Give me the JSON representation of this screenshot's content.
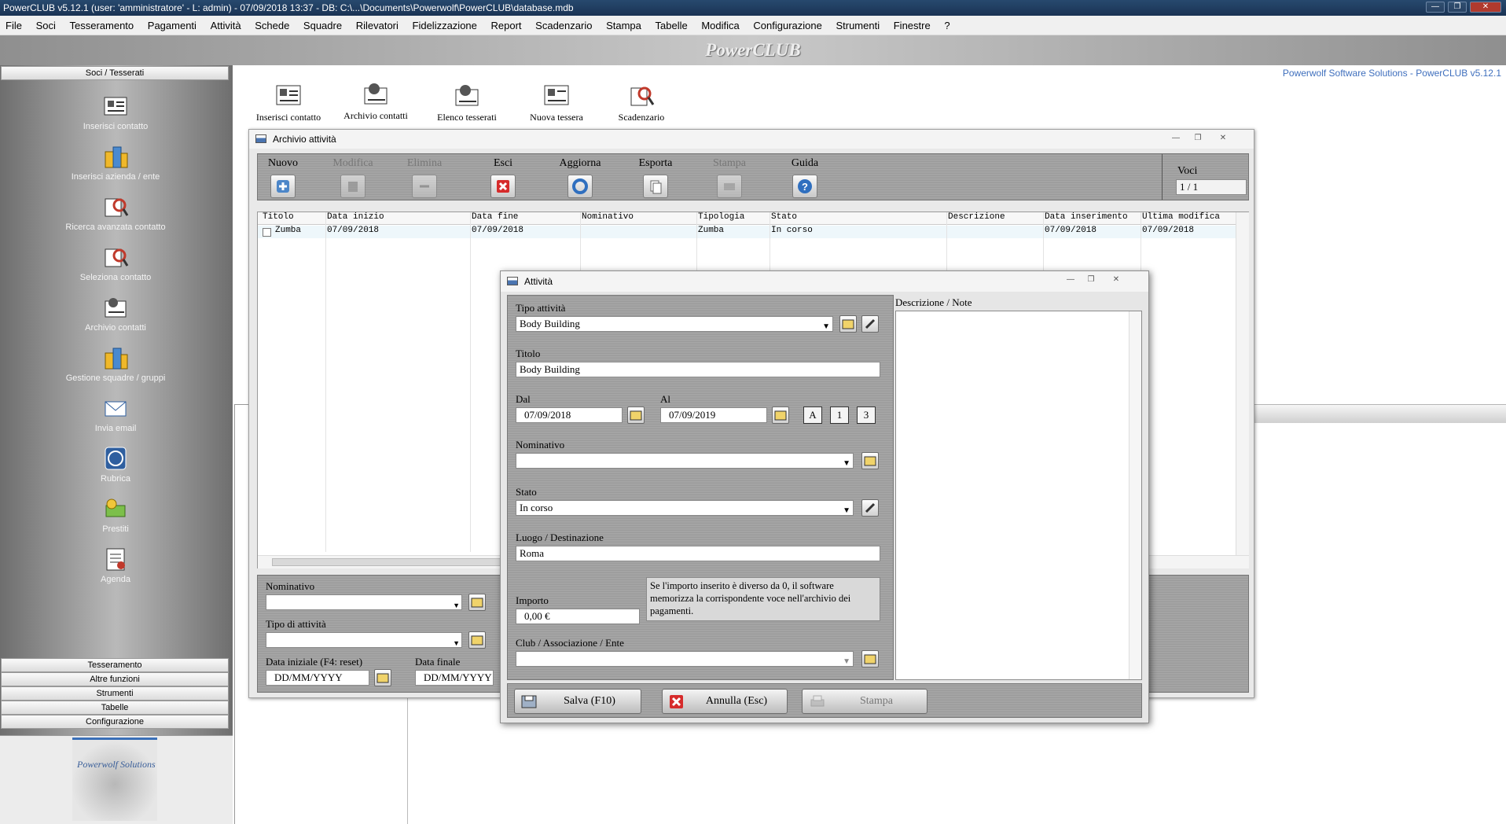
{
  "window": {
    "title": "PowerCLUB v5.12.1  (user: 'amministratore'  - L: admin) - 07/09/2018 13:37 - DB: C:\\...\\Documents\\Powerwolf\\PowerCLUB\\database.mdb",
    "minimize": "—",
    "maximize": "❐",
    "close": "✕"
  },
  "menu": [
    "File",
    "Soci",
    "Tesseramento",
    "Pagamenti",
    "Attività",
    "Schede",
    "Squadre",
    "Rilevatori",
    "Fidelizzazione",
    "Report",
    "Scadenzario",
    "Stampa",
    "Tabelle",
    "Modifica",
    "Configurazione",
    "Strumenti",
    "Finestre",
    "?"
  ],
  "brand": "PowerCLUB",
  "vendor": "Powerwolf Software Solutions - PowerCLUB v5.12.1",
  "left_panel": {
    "header": "Soci / Tesserati",
    "items": [
      {
        "label": "Inserisci contatto",
        "icon": "card-icon"
      },
      {
        "label": "Inserisci azienda / ente",
        "icon": "building-icon"
      },
      {
        "label": "Ricerca avanzata contatto",
        "icon": "search-contact-icon"
      },
      {
        "label": "Seleziona contatto",
        "icon": "select-contact-icon"
      },
      {
        "label": "Archivio contatti",
        "icon": "archive-icon"
      },
      {
        "label": "Gestione squadre / gruppi",
        "icon": "group-icon"
      },
      {
        "label": "Invia email",
        "icon": "envelope-icon"
      },
      {
        "label": "Rubrica",
        "icon": "phone-icon"
      },
      {
        "label": "Prestiti",
        "icon": "money-icon"
      },
      {
        "label": "Agenda",
        "icon": "agenda-icon"
      }
    ],
    "sections": [
      "Tesseramento",
      "Altre funzioni",
      "Strumenti",
      "Tabelle",
      "Configurazione"
    ],
    "logo_text": "Powerwolf Solutions"
  },
  "toolbar": [
    {
      "label": "Inserisci contatto",
      "icon": "card-icon"
    },
    {
      "label": "Archivio contatti",
      "icon": "archive-icon"
    },
    {
      "label": "Elenco tesserati",
      "icon": "list-icon"
    },
    {
      "label": "Nuova tessera",
      "icon": "new-card-icon"
    },
    {
      "label": "Scadenzario",
      "icon": "schedule-icon"
    }
  ],
  "archive": {
    "title": "Archivio attività",
    "buttons": [
      {
        "label": "Nuovo",
        "enabled": true,
        "icon": "plus-icon"
      },
      {
        "label": "Modifica",
        "enabled": false,
        "icon": "edit-icon"
      },
      {
        "label": "Elimina",
        "enabled": false,
        "icon": "minus-icon"
      },
      {
        "label": "Esci",
        "enabled": true,
        "icon": "exit-icon"
      },
      {
        "label": "Aggiorna",
        "enabled": true,
        "icon": "refresh-icon"
      },
      {
        "label": "Esporta",
        "enabled": true,
        "icon": "export-icon"
      },
      {
        "label": "Stampa",
        "enabled": false,
        "icon": "print-icon"
      },
      {
        "label": "Guida",
        "enabled": true,
        "icon": "help-icon"
      }
    ],
    "voci_label": "Voci",
    "voci_value": "1 / 1",
    "columns": [
      "Titolo",
      "Data inizio",
      "Data fine",
      "Nominativo",
      "Tipologia",
      "Stato",
      "Descrizione",
      "Data inserimento",
      "Ultima modifica"
    ],
    "rows": [
      {
        "titolo": "Zumba",
        "data_inizio": "07/09/2018",
        "data_fine": "07/09/2018",
        "nominativo": "",
        "tipologia": "Zumba",
        "stato": "In corso",
        "descrizione": "",
        "data_inserimento": "07/09/2018",
        "ultima_modifica": "07/09/2018"
      }
    ],
    "filters": {
      "nominativo_label": "Nominativo",
      "tipo_label": "Tipo di attività",
      "data_iniziale_label": "Data iniziale (F4: reset)",
      "data_finale_label": "Data finale",
      "date_placeholder": "DD/MM/YYYY"
    }
  },
  "activity": {
    "title": "Attività",
    "tipo_label": "Tipo attività",
    "tipo_value": "Body Building",
    "titolo_label": "Titolo",
    "titolo_value": "Body Building",
    "dal_label": "Dal",
    "dal_value": "07/09/2018",
    "al_label": "Al",
    "al_value": "07/09/2019",
    "quick_buttons": [
      "A",
      "1",
      "3"
    ],
    "nominativo_label": "Nominativo",
    "nominativo_value": "",
    "stato_label": "Stato",
    "stato_value": "In corso",
    "luogo_label": "Luogo / Destinazione",
    "luogo_value": "Roma",
    "importo_label": "Importo",
    "importo_value": "0,00 €",
    "importo_note": "Se l'importo inserito è diverso da 0, il software memorizza la corrispondente voce nell'archivio dei pagamenti.",
    "club_label": "Club / Associazione / Ente",
    "club_value": "",
    "descr_label": "Descrizione / Note",
    "save_label": "Salva (F10)",
    "cancel_label": "Annulla (Esc)",
    "print_label": "Stampa"
  }
}
